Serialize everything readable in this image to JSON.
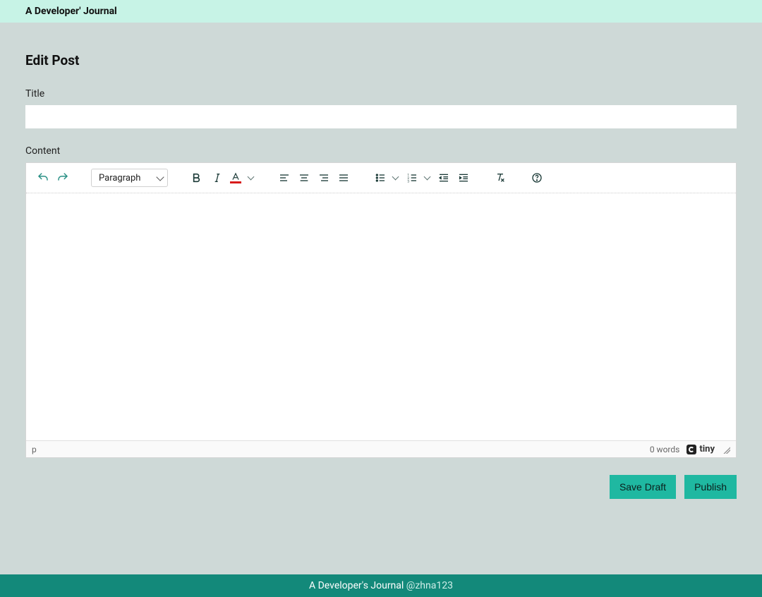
{
  "header": {
    "site_title": "A Developer' Journal"
  },
  "page": {
    "heading": "Edit Post",
    "title_label": "Title",
    "title_value": "",
    "content_label": "Content"
  },
  "editor": {
    "blocks_selected": "Paragraph",
    "statusbar": {
      "path": "p",
      "wordcount": "0 words",
      "brand": "tiny"
    },
    "icons": {
      "undo": "undo-icon",
      "redo": "redo-icon",
      "bold": "bold-icon",
      "italic": "italic-icon",
      "forecolor": "text-color-icon",
      "align_left": "align-left-icon",
      "align_center": "align-center-icon",
      "align_right": "align-right-icon",
      "align_justify": "align-justify-icon",
      "bullet_list": "bullet-list-icon",
      "number_list": "numbered-list-icon",
      "outdent": "outdent-icon",
      "indent": "indent-icon",
      "clear_format": "clear-formatting-icon",
      "help": "help-icon"
    }
  },
  "actions": {
    "save_draft": "Save Draft",
    "publish": "Publish"
  },
  "footer": {
    "text": "A Developer's Journal ",
    "handle": "@zhna123"
  },
  "colors": {
    "accent": "#1fb8a1",
    "header_bg": "#c7f3e6",
    "page_bg": "#ced9d7",
    "footer_bg": "#13897a",
    "toolbar_icon": "#1b3a37",
    "forecolor_swatch": "#d81b1b"
  }
}
